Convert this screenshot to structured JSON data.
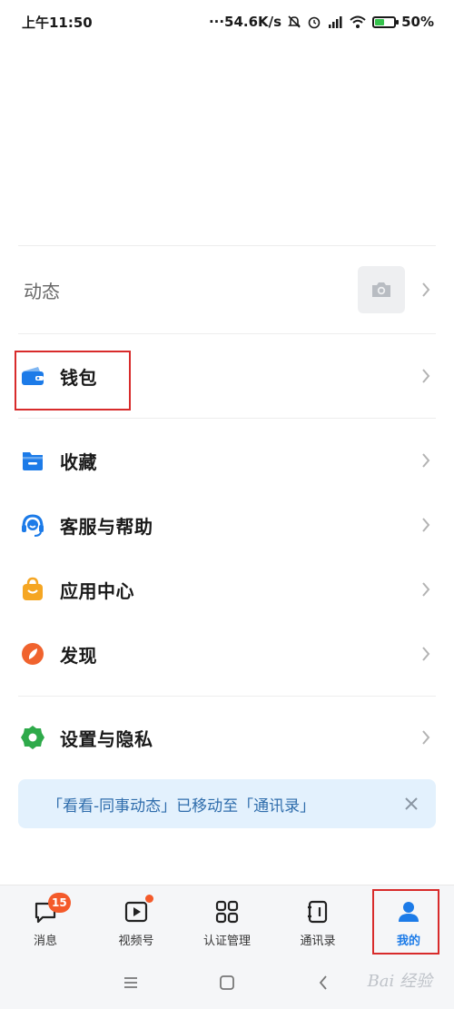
{
  "status_bar": {
    "time": "上午11:50",
    "network_speed": "54.6K/s",
    "battery": "50%",
    "battery_level": 0.5,
    "icons": [
      "mute-icon",
      "alarm-icon",
      "hd-signal-icon",
      "wifi-icon",
      "battery-icon"
    ]
  },
  "moments": {
    "label": "动态",
    "icon": "camera-icon"
  },
  "menu": {
    "wallet": {
      "label": "钱包",
      "icon": "wallet-icon",
      "color": "#1c7be8"
    },
    "favorites": {
      "label": "收藏",
      "icon": "folder-icon",
      "color": "#1c7be8"
    },
    "support": {
      "label": "客服与帮助",
      "icon": "headset-icon",
      "color": "#1c7be8"
    },
    "apps": {
      "label": "应用中心",
      "icon": "shopping-bag-icon",
      "color": "#f5a623"
    },
    "discover": {
      "label": "发现",
      "icon": "compass-icon",
      "color": "#f0632e"
    },
    "settings": {
      "label": "设置与隐私",
      "icon": "gear-icon",
      "color": "#2eaa4a"
    }
  },
  "notice": {
    "text": "「看看-同事动态」已移动至「通讯录」",
    "close_icon": "close-icon"
  },
  "tabs": [
    {
      "label": "消息",
      "icon": "chat-icon",
      "badge": "15"
    },
    {
      "label": "视频号",
      "icon": "video-icon",
      "dot": true
    },
    {
      "label": "认证管理",
      "icon": "grid-icon"
    },
    {
      "label": "通讯录",
      "icon": "contacts-icon"
    },
    {
      "label": "我的",
      "icon": "profile-icon",
      "active": true
    }
  ],
  "watermark": "Bai 经验",
  "colors": {
    "accent": "#1c7be8",
    "highlight": "#d82b2b",
    "badge": "#f45a2a",
    "notice_bg": "#e3f1fd"
  }
}
